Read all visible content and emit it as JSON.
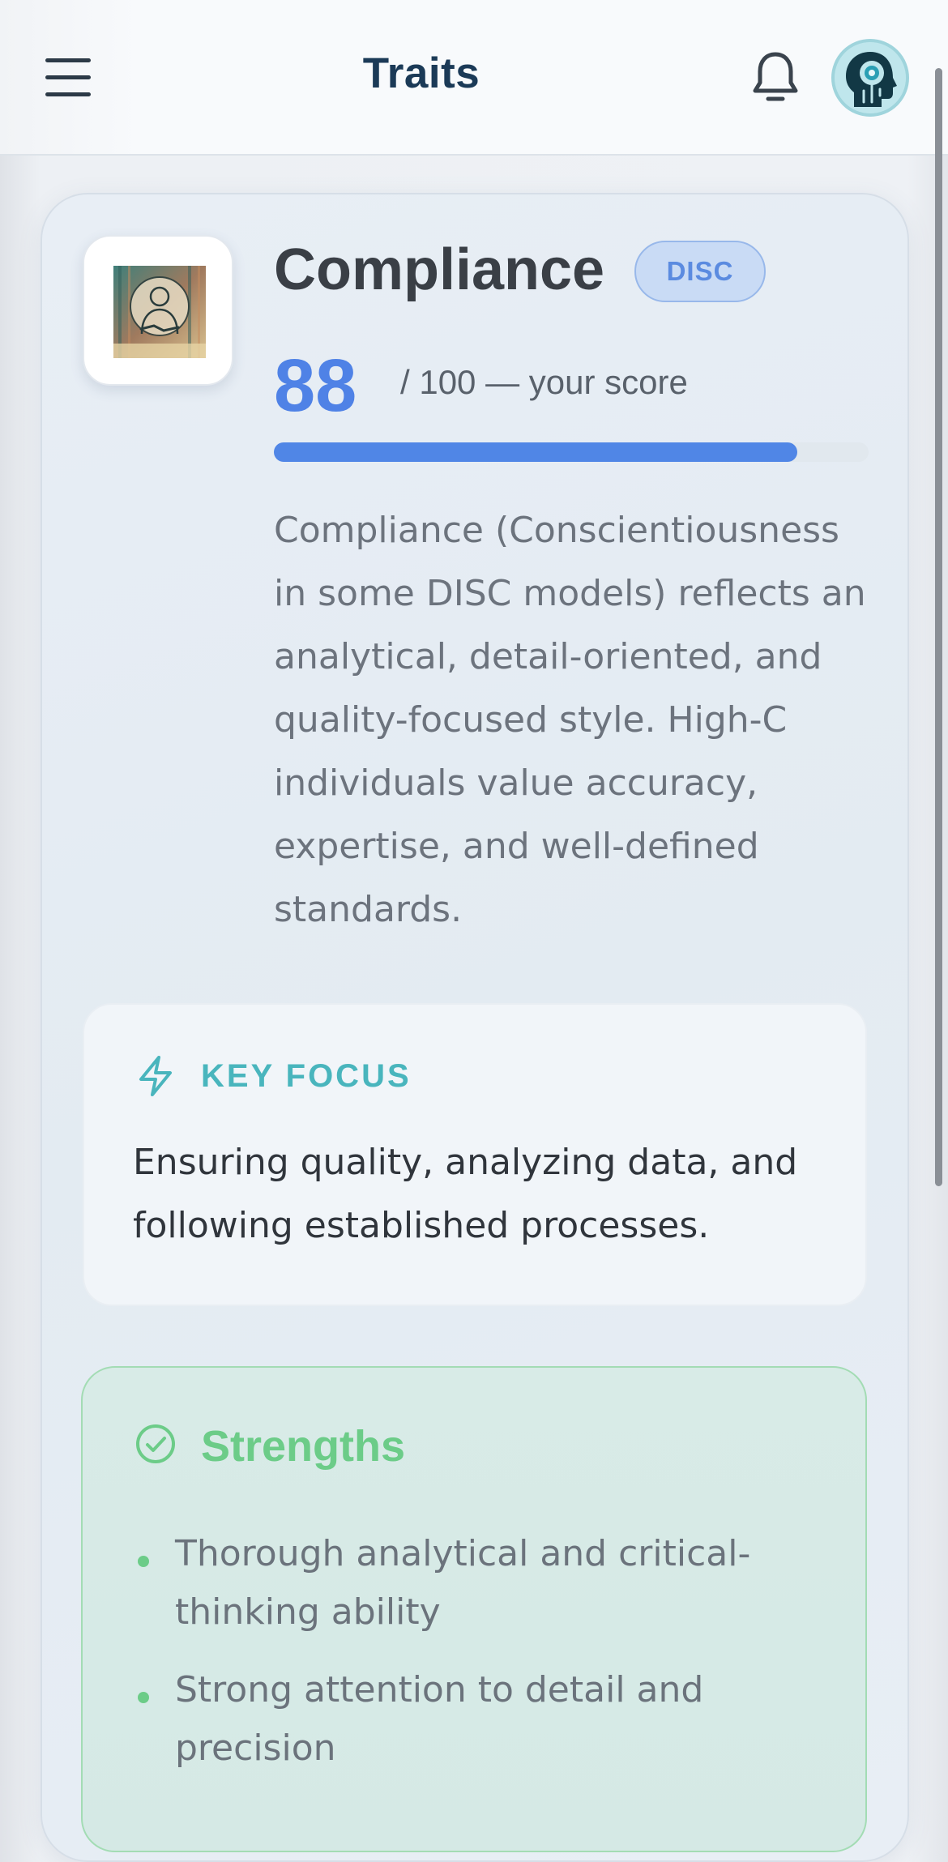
{
  "header": {
    "title": "Traits",
    "menu_icon": "hamburger-menu-icon",
    "notification_icon": "bell-icon",
    "avatar_icon": "ai-head-avatar"
  },
  "trait": {
    "name": "Compliance",
    "tag": "DISC",
    "score": "88",
    "score_suffix": "/ 100 — your score",
    "score_fraction": 0.88,
    "description": "Compliance (Conscientiousness in some DISC models) reflects an analytical, detail-oriented, and quality-focused style. High-C individuals value accuracy, expertise, and well-defined standards.",
    "image_icon": "handshake-person-illustration"
  },
  "key_focus": {
    "label": "KEY FOCUS",
    "icon": "lightning-bolt-icon",
    "text": "Ensuring quality, analyzing data, and following established processes."
  },
  "strengths": {
    "title": "Strengths",
    "icon": "check-circle-icon",
    "items": [
      "Thorough analytical and critical-thinking ability",
      "Strong attention to detail and precision"
    ]
  },
  "colors": {
    "accent_blue": "#4f82e6",
    "header_title": "#1b3a57",
    "focus_teal": "#49b5bd",
    "strength_green": "#6ccc88"
  }
}
